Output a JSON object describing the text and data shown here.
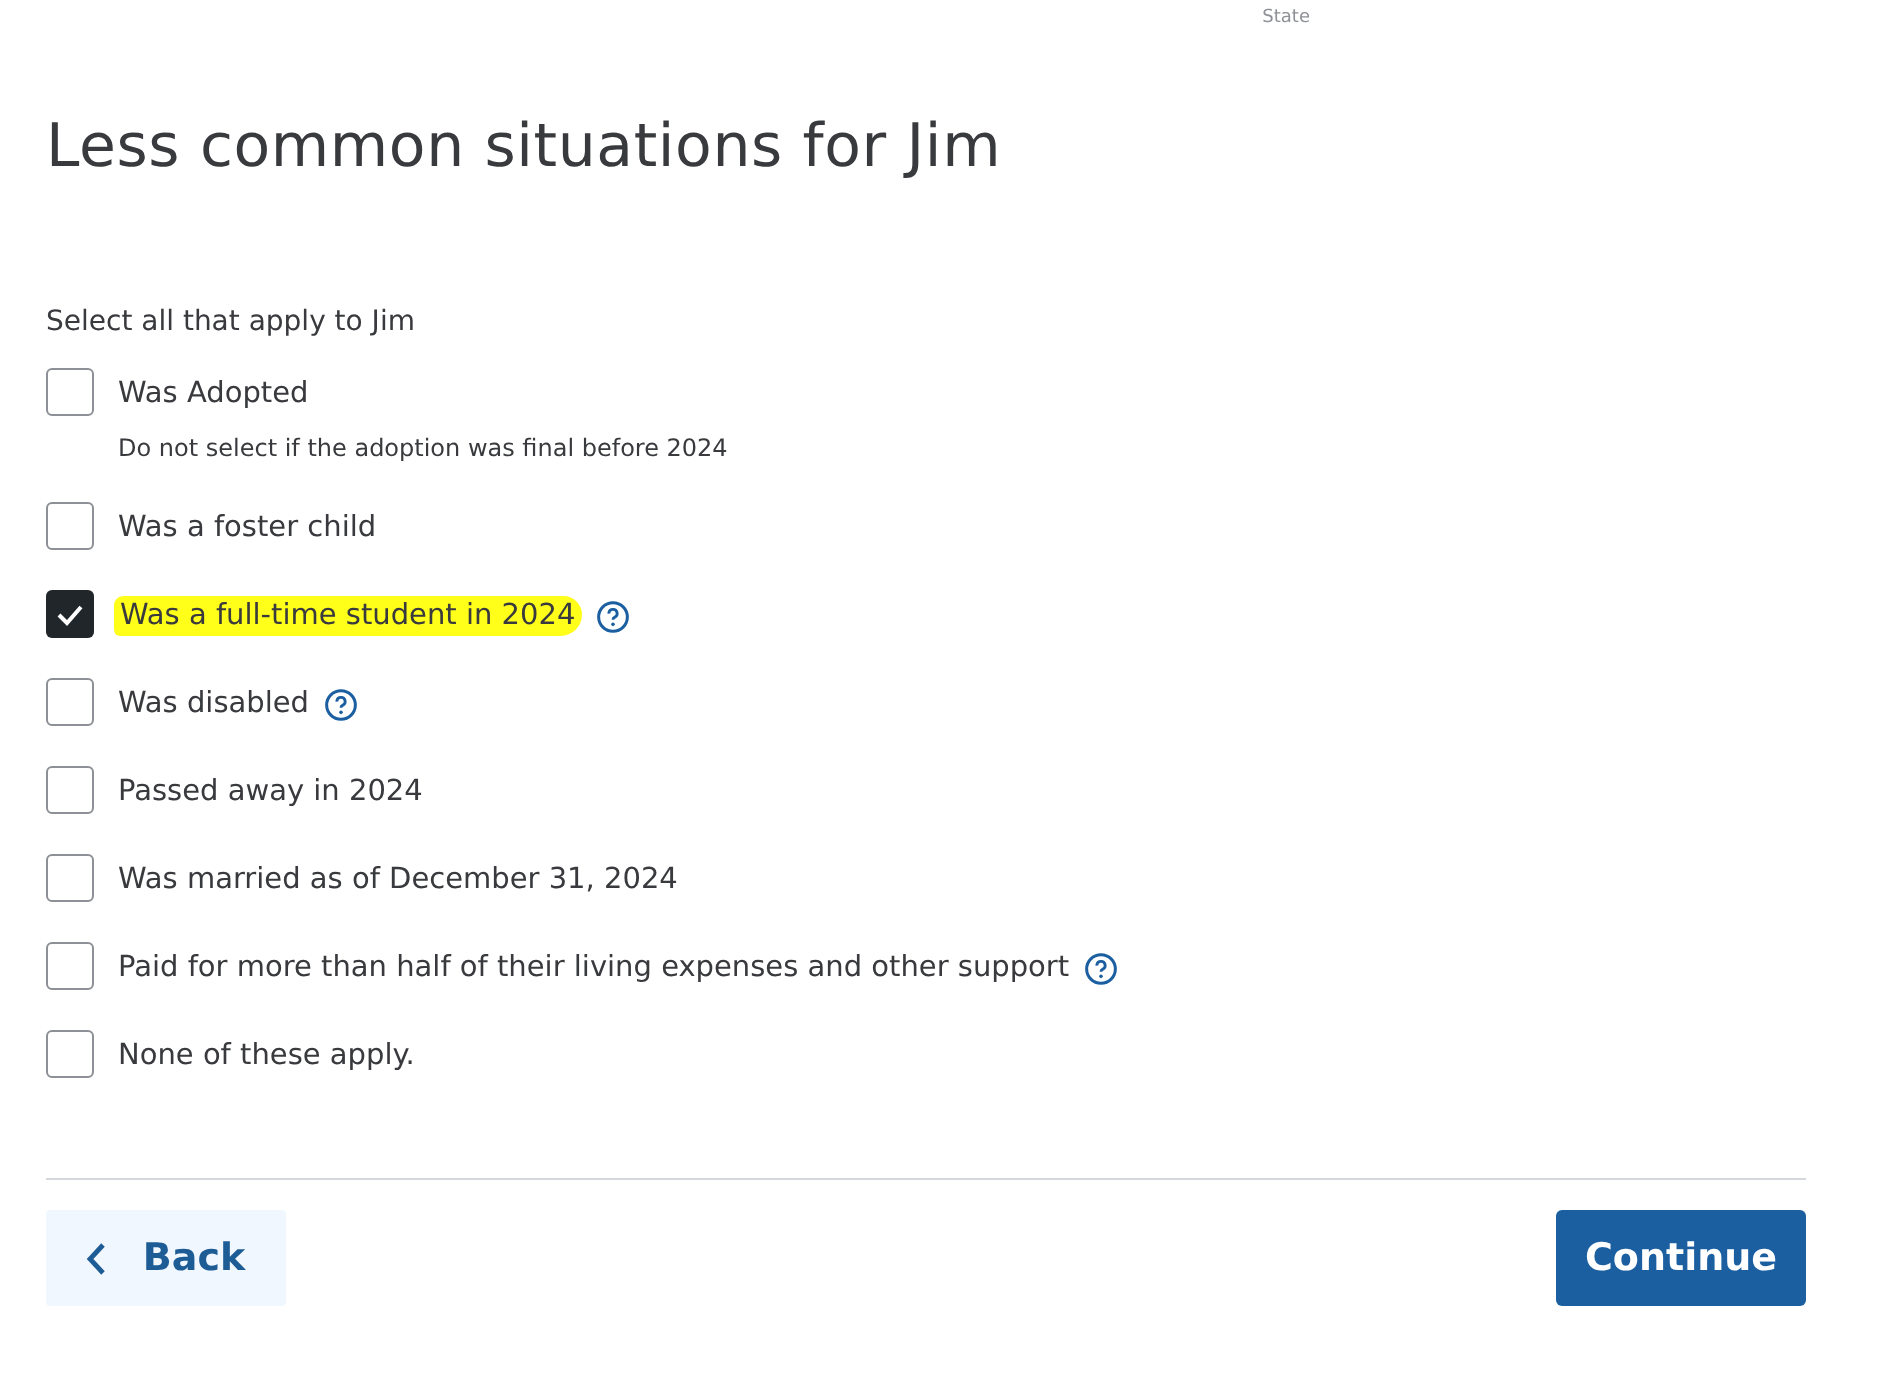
{
  "top_label": "State",
  "title": "Less common situations for Jim",
  "instruction": "Select all that apply to Jim",
  "options": [
    {
      "label": "Was Adopted",
      "hint": "Do not select if the adoption was final before 2024",
      "checked": false,
      "help": false,
      "highlighted": false
    },
    {
      "label": "Was a foster child",
      "checked": false,
      "help": false,
      "highlighted": false
    },
    {
      "label": "Was a full-time student in 2024",
      "checked": true,
      "help": true,
      "highlighted": true
    },
    {
      "label": "Was disabled",
      "checked": false,
      "help": true,
      "highlighted": false
    },
    {
      "label": "Passed away in 2024",
      "checked": false,
      "help": false,
      "highlighted": false
    },
    {
      "label": "Was married as of December 31, 2024",
      "checked": false,
      "help": false,
      "highlighted": false
    },
    {
      "label": "Paid for more than half of their living expenses and other support",
      "checked": false,
      "help": true,
      "highlighted": false
    },
    {
      "label": "None of these apply.",
      "checked": false,
      "help": false,
      "highlighted": false
    }
  ],
  "buttons": {
    "back": "Back",
    "continue": "Continue"
  }
}
